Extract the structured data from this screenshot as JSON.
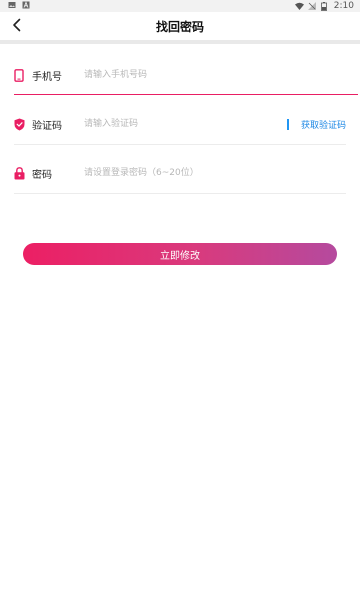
{
  "status_bar": {
    "time": "2:10",
    "icons": [
      "image-icon",
      "a-icon",
      "wifi-icon",
      "signal-off-icon",
      "battery-icon"
    ]
  },
  "header": {
    "title": "找回密码",
    "back_icon": "chevron-left-icon"
  },
  "form": {
    "phone": {
      "label": "手机号",
      "placeholder": "请输入手机号码",
      "value": "",
      "icon": "phone-icon"
    },
    "code": {
      "label": "验证码",
      "placeholder": "请输入验证码",
      "value": "",
      "icon": "shield-check-icon",
      "get_code_label": "获取验证码"
    },
    "password": {
      "label": "密码",
      "placeholder": "请设置登录密码（6~20位）",
      "value": "",
      "icon": "lock-icon"
    }
  },
  "submit": {
    "label": "立即修改"
  },
  "colors": {
    "accent": "#e91e63",
    "link": "#1e88e5"
  }
}
